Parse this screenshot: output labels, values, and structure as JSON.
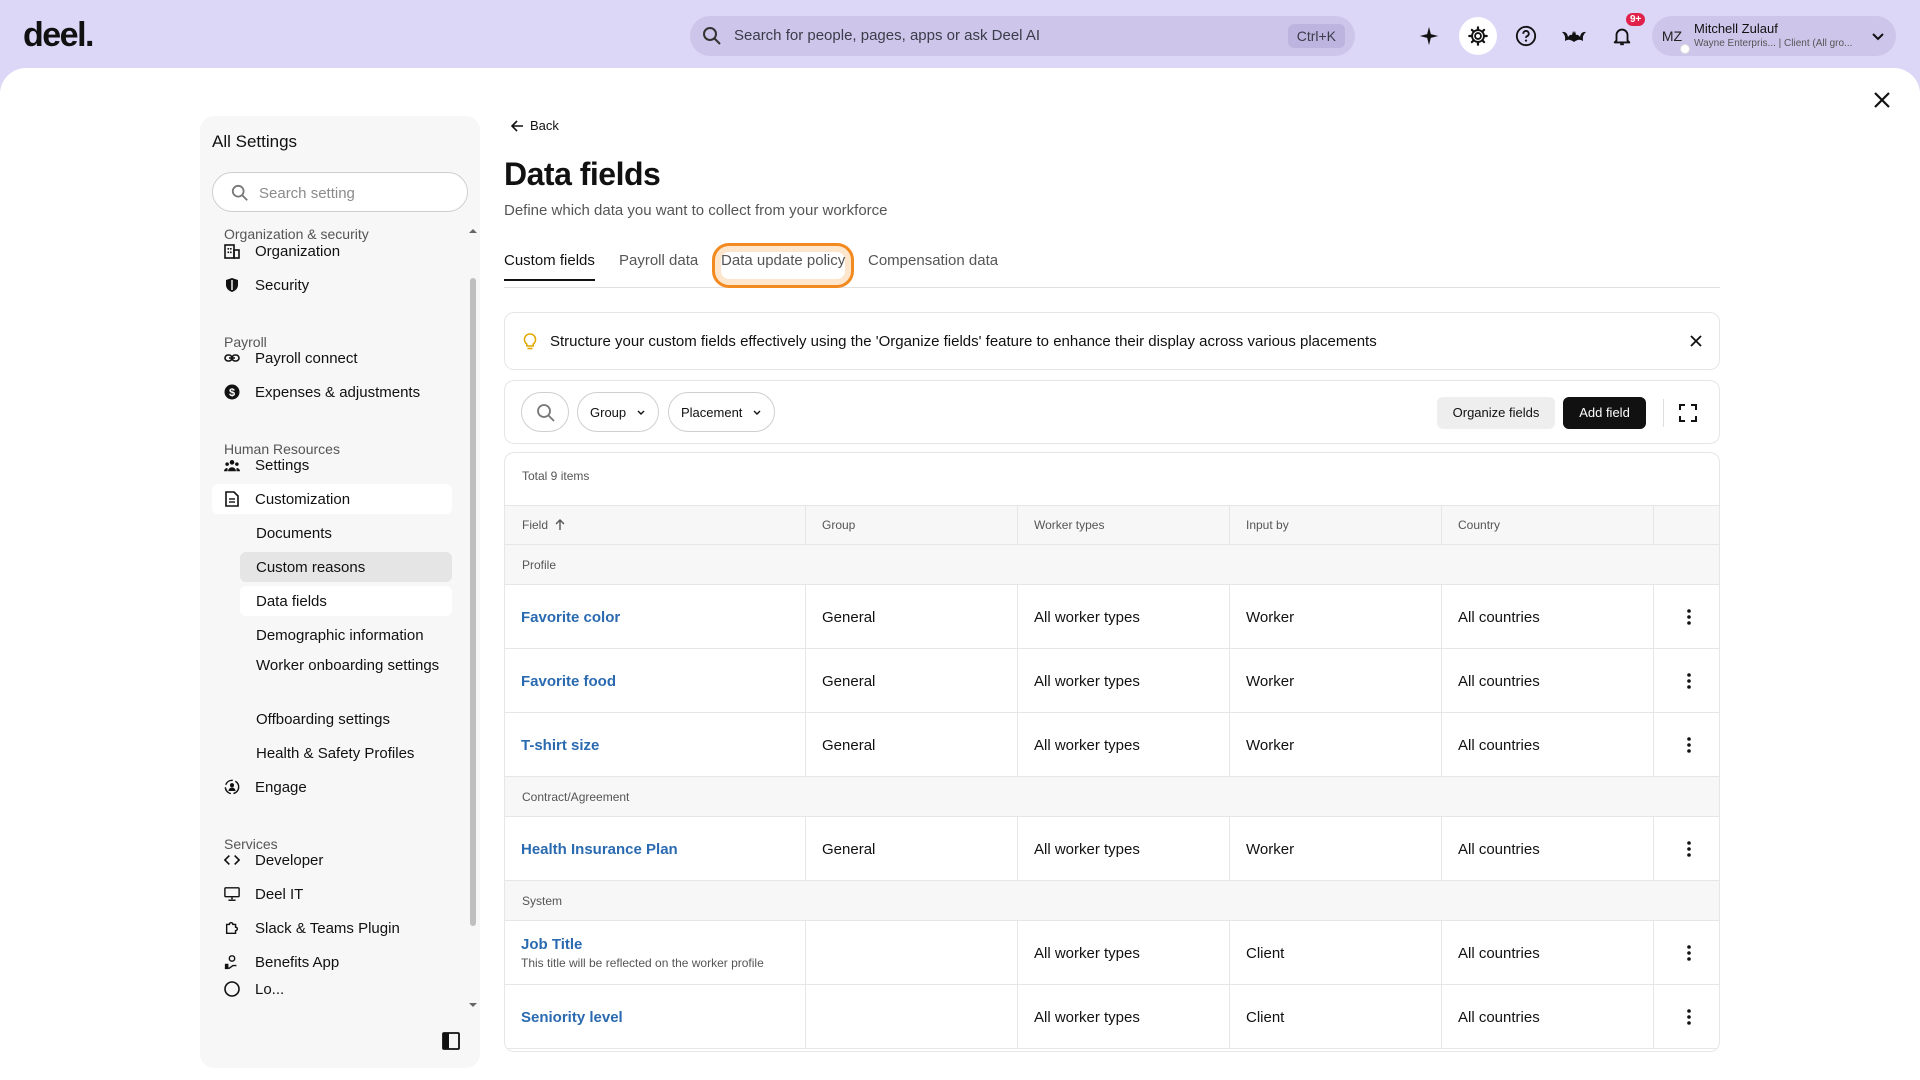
{
  "topbar": {
    "logo": "deel.",
    "search_placeholder": "Search for people, pages, apps or ask Deel AI",
    "shortcut": "Ctrl+K",
    "notifications_badge": "9+",
    "user": {
      "initials": "MZ",
      "name": "Mitchell Zulauf",
      "subtitle": "Wayne Enterpris... | Client (All gro..."
    }
  },
  "sidebar": {
    "title": "All Settings",
    "search_placeholder": "Search setting",
    "sections": {
      "org": "Organization & security",
      "payroll": "Payroll",
      "hr": "Human Resources",
      "services": "Services"
    },
    "items": {
      "organization": "Organization",
      "security": "Security",
      "payroll_connect": "Payroll connect",
      "expenses": "Expenses & adjustments",
      "settings": "Settings",
      "customization": "Customization",
      "documents": "Documents",
      "custom_reasons": "Custom reasons",
      "data_fields": "Data fields",
      "demographic": "Demographic information",
      "worker_onboarding": "Worker onboarding settings",
      "offboarding": "Offboarding settings",
      "health_safety": "Health & Safety Profiles",
      "engage": "Engage",
      "developer": "Developer",
      "deel_it": "Deel IT",
      "slack": "Slack & Teams Plugin",
      "benefits": "Benefits App",
      "partial": "Lo..."
    }
  },
  "main": {
    "back": "Back",
    "title": "Data fields",
    "subtitle": "Define which data you want to collect from your workforce",
    "tabs": [
      "Custom fields",
      "Payroll data",
      "Data update policy",
      "Compensation data"
    ],
    "info_text": "Structure your custom fields effectively using the 'Organize fields' feature to enhance their display across various placements",
    "filters": {
      "group": "Group",
      "placement": "Placement",
      "organize": "Organize fields",
      "add": "Add field"
    },
    "table": {
      "total": "Total 9 items",
      "columns": [
        "Field",
        "Group",
        "Worker types",
        "Input by",
        "Country"
      ],
      "groups": {
        "profile": "Profile",
        "contract": "Contract/Agreement",
        "system": "System"
      },
      "rows": [
        {
          "field": "Favorite color",
          "desc": "",
          "group": "General",
          "worker_types": "All worker types",
          "input_by": "Worker",
          "country": "All countries"
        },
        {
          "field": "Favorite food",
          "desc": "",
          "group": "General",
          "worker_types": "All worker types",
          "input_by": "Worker",
          "country": "All countries"
        },
        {
          "field": "T-shirt size",
          "desc": "",
          "group": "General",
          "worker_types": "All worker types",
          "input_by": "Worker",
          "country": "All countries"
        },
        {
          "field": "Health Insurance Plan",
          "desc": "",
          "group": "General",
          "worker_types": "All worker types",
          "input_by": "Worker",
          "country": "All countries"
        },
        {
          "field": "Job Title",
          "desc": "This title will be reflected on the worker profile",
          "group": "",
          "worker_types": "All worker types",
          "input_by": "Client",
          "country": "All countries"
        },
        {
          "field": "Seniority level",
          "desc": "",
          "group": "",
          "worker_types": "All worker types",
          "input_by": "Client",
          "country": "All countries"
        }
      ]
    }
  }
}
